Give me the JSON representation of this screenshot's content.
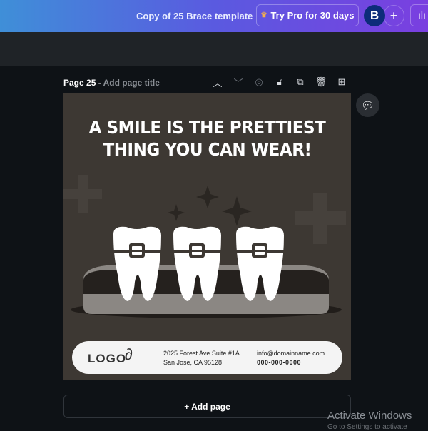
{
  "header": {
    "doc_title": "Copy of 25 Brace template",
    "try_pro": "Try Pro for 30 days",
    "avatar_initial": "B",
    "plus": "+",
    "stats_icon": "bar-chart-icon"
  },
  "page": {
    "label": "Page 25 - ",
    "title_placeholder": "Add page title"
  },
  "design": {
    "headline_line1": "A SMILE IS THE PRETTIEST",
    "headline_line2": "THING YOU CAN WEAR!",
    "logo": "LOGO",
    "address_line1": "2025 Forest Ave Suite #1A",
    "address_line2": "San Jose, CA 95128",
    "email": "info@domainname.com",
    "phone": "000-000-0000",
    "colors": {
      "background": "#3d3833",
      "accent": "#ffffff"
    }
  },
  "add_page": "+ Add page",
  "watermark": {
    "title": "Activate Windows",
    "subtitle": "Go to Settings to activate"
  }
}
